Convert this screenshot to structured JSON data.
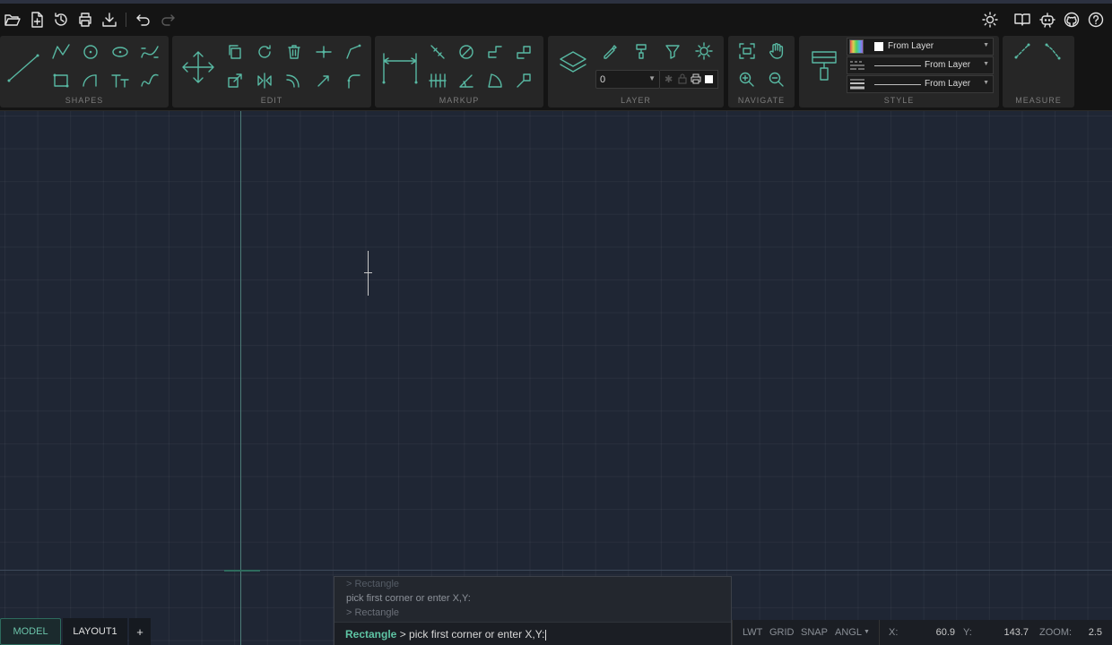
{
  "quick_access": {
    "icons": [
      "open-folder-icon",
      "new-file-icon",
      "history-icon",
      "print-icon",
      "download-icon",
      "undo-icon",
      "redo-icon"
    ]
  },
  "top_right": {
    "icons": [
      "theme-sun-icon",
      "docs-book-icon",
      "ai-assistant-icon",
      "github-icon",
      "help-icon"
    ]
  },
  "ribbon": {
    "panels": {
      "shapes": "SHAPES",
      "edit": "EDIT",
      "markup": "MARKUP",
      "layer": "LAYER",
      "navigate": "NAVIGATE",
      "style": "STYLE",
      "measure": "MEASURE"
    },
    "layer_select": "0",
    "style": {
      "color": "From Layer",
      "linetype": "From Layer",
      "lineweight": "From Layer"
    }
  },
  "command": {
    "history": [
      "> Rectangle",
      "pick first corner or enter X,Y:",
      "> Rectangle"
    ],
    "current_keyword": "Rectangle",
    "current_prompt": " > pick first corner or enter X,Y:"
  },
  "tabs": {
    "model": "MODEL",
    "layout1": "LAYOUT1",
    "add": "+"
  },
  "status": {
    "lwt": "LWT",
    "grid": "GRID",
    "snap": "SNAP",
    "angl": "ANGL",
    "x_label": "X:",
    "x_value": "60.9",
    "y_label": "Y:",
    "y_value": "143.7",
    "zoom_label": "ZOOM:",
    "zoom_value": "2.5"
  },
  "colors": {
    "accent": "#58b9a3",
    "canvas": "#1f2634",
    "ribbon_panel": "#262626"
  }
}
